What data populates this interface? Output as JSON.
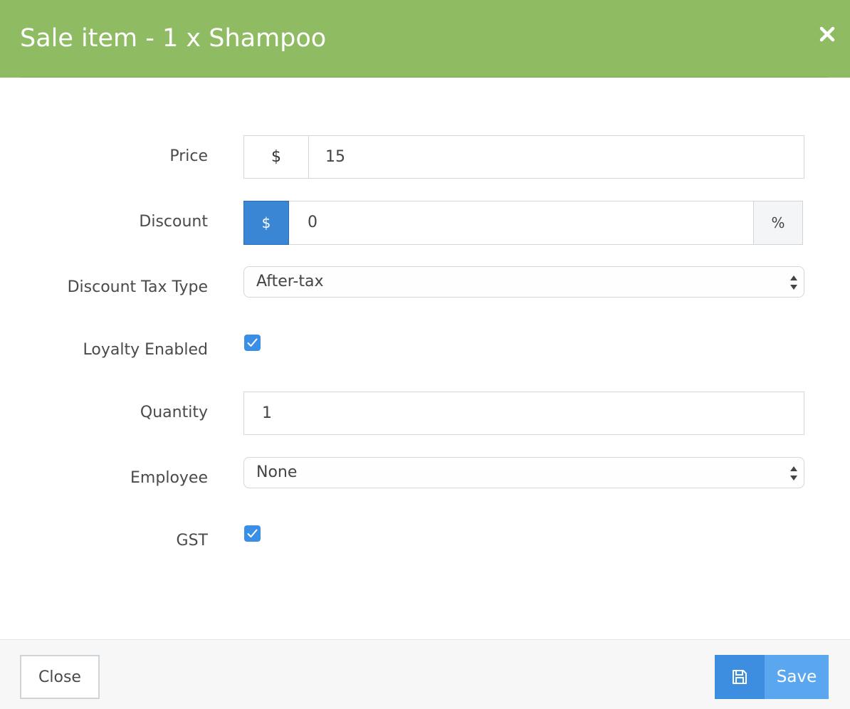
{
  "modal": {
    "title": "Sale item - 1 x Shampoo",
    "close_icon": "close-x-icon",
    "header_color": "#8fbc62"
  },
  "form": {
    "price": {
      "label": "Price",
      "addon": "$",
      "value": "15"
    },
    "discount": {
      "label": "Discount",
      "mode_dollar": "$",
      "value": "0",
      "mode_percent": "%",
      "active_mode": "$"
    },
    "discount_tax_type": {
      "label": "Discount Tax Type",
      "selected": "After-tax"
    },
    "loyalty_enabled": {
      "label": "Loyalty Enabled",
      "checked": true
    },
    "quantity": {
      "label": "Quantity",
      "value": "1"
    },
    "employee": {
      "label": "Employee",
      "selected": "None"
    },
    "gst": {
      "label": "GST",
      "checked": true
    }
  },
  "footer": {
    "close_label": "Close",
    "save_label": "Save",
    "save_icon": "floppy-disk-icon"
  },
  "colors": {
    "accent": "#3a86d4",
    "checkbox": "#3a8ee6",
    "save_button": "#5aa7ef"
  }
}
